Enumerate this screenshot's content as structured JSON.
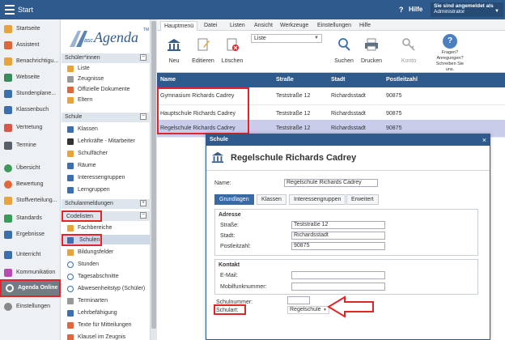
{
  "topbar": {
    "title": "Start",
    "help_symbol": "?",
    "help": "Hilfe",
    "login_line1": "Sie sind angemeldet als",
    "login_line2": "Administrator"
  },
  "leftnav": [
    {
      "label": "Startseite",
      "icon": "home-icon",
      "color": "#e8a33b"
    },
    {
      "label": "Assistent",
      "icon": "wand-icon",
      "color": "#e0673b"
    },
    {
      "label": "Benachrichtigu...",
      "icon": "mail-icon",
      "color": "#e8a33b"
    },
    {
      "label": "Webseite",
      "icon": "web-icon",
      "color": "#3b8a5a"
    },
    {
      "label": "Stundenplane...",
      "icon": "calendar-icon",
      "color": "#3b6fb0"
    },
    {
      "label": "Klassenbuch",
      "icon": "book-icon",
      "color": "#3b6fb0"
    },
    {
      "label": "Vertretung",
      "icon": "substitute-icon",
      "color": "#d9564a"
    },
    {
      "label": "Termine",
      "icon": "events-icon",
      "color": "#58606a"
    },
    {
      "label": "Übersicht",
      "icon": "overview-icon",
      "color": "#3a9a5a"
    },
    {
      "label": "Bewertung",
      "icon": "rating-icon",
      "color": "#e0673b"
    },
    {
      "label": "Stoffverteilung...",
      "icon": "distribution-icon",
      "color": "#e8a33b"
    },
    {
      "label": "Standards",
      "icon": "standards-icon",
      "color": "#3a9a5a"
    },
    {
      "label": "Ergebnisse",
      "icon": "results-icon",
      "color": "#3b6fb0"
    },
    {
      "label": "Unterricht",
      "icon": "lesson-icon",
      "color": "#3b6fb0"
    },
    {
      "label": "Kommunikation",
      "icon": "communication-icon",
      "color": "#b84ab0"
    },
    {
      "label": "Agenda Online",
      "icon": "agenda-icon",
      "color": "#ffffff"
    },
    {
      "label": "Einstellungen",
      "icon": "settings-icon",
      "color": "#888888"
    }
  ],
  "logo": {
    "asc": "asc",
    "agenda": "Agenda",
    "tm": "TM"
  },
  "midpanel": {
    "sec_schueler": "Schüler*innen",
    "schueler_items": [
      "Liste",
      "Zeugnisse",
      "Offizielle Dokumente",
      "Eltern"
    ],
    "sec_schule": "Schule",
    "schule_items": [
      "Klassen",
      "Lehrkräfte - Mitarbeiter",
      "Schulfächer",
      "Räume",
      "Interessengruppen",
      "Lerngruppen"
    ],
    "sec_anmeldungen": "Schulanmeldungen",
    "sec_codelisten": "Codelisten",
    "code_items": [
      "Fachbereiche",
      "Schulen",
      "Bildungsfelder",
      "Stunden",
      "Tagesabschnitte",
      "Abwesenheitstyp (Schüler)",
      "Terminarten",
      "Lehrbefähigung",
      "Texte für Mitteilungen",
      "Klausel im Zeugnis"
    ],
    "expand_minus": "−",
    "expand_plus": "+"
  },
  "ribbon": {
    "tabs": [
      "Hauptmenü",
      "Datei",
      "Listen",
      "Ansicht",
      "Werkzeuge",
      "Einstellungen",
      "Hilfe"
    ],
    "new": "Neu",
    "edit": "Editieren",
    "delete": "Löschen",
    "list_select": "Liste",
    "search": "Suchen",
    "print": "Drucken",
    "account": "Konto",
    "help_q": "?",
    "help_text": "Fragen? Anregungen? Schreiben Sie uns."
  },
  "grid": {
    "headers": [
      "Name",
      "Straße",
      "Stadt",
      "Postleitzahl"
    ],
    "rows": [
      [
        "Gymnasium Richards Cadrey",
        "Teststraße 12",
        "Richardsstadt",
        "90875"
      ],
      [
        "Hauptschule Richards Cadrey",
        "Teststraße 12",
        "Richardsstadt",
        "90875"
      ],
      [
        "Regelschule Richards Cadrey",
        "Teststraße 12",
        "Richardsstadt",
        "90875"
      ]
    ]
  },
  "dialog": {
    "title": "Schule",
    "close": "×",
    "heading": "Regelschule Richards Cadrey",
    "name_label": "Name:",
    "name_value": "Regelschule Richards Cadrey",
    "tabs": [
      "Grundlagen",
      "Klassen",
      "Interessengruppen",
      "Erweitert"
    ],
    "adresse_title": "Adresse",
    "strasse_label": "Straße:",
    "strasse_value": "Teststraße 12",
    "stadt_label": "Stadt:",
    "stadt_value": "Richardsstadt",
    "plz_label": "Postleitzahl:",
    "plz_value": "90875",
    "kontakt_title": "Kontakt",
    "email_label": "E-Mail:",
    "mobil_label": "Mobilfunknummer:",
    "schulnummer_label": "Schulnummer:",
    "schulart_label": "Schulart:",
    "schulart_value": "Regelschule"
  },
  "colors": {
    "accent": "#2f5b8c",
    "highlight": "#e0262a",
    "selected_row": "#c9cdea"
  }
}
